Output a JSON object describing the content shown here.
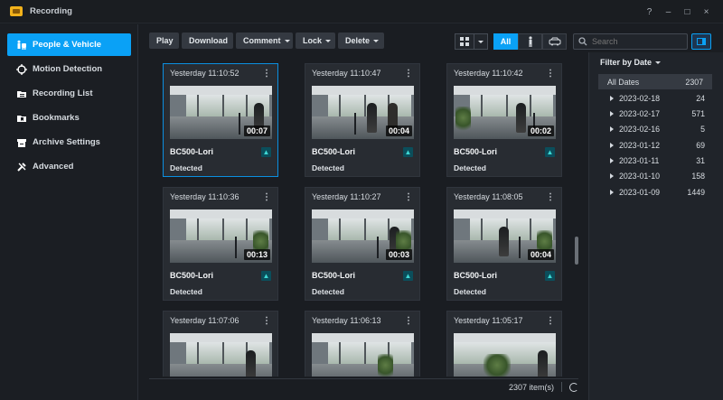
{
  "window": {
    "title": "Recording"
  },
  "window_controls": [
    "?",
    "–",
    "□",
    "×"
  ],
  "sidebar": {
    "items": [
      {
        "label": "People & Vehicle",
        "icon": "people-vehicle-icon",
        "active": true
      },
      {
        "label": "Motion Detection",
        "icon": "motion-target-icon",
        "active": false
      },
      {
        "label": "Recording List",
        "icon": "folder-list-icon",
        "active": false
      },
      {
        "label": "Bookmarks",
        "icon": "bookmark-folder-icon",
        "active": false
      },
      {
        "label": "Archive Settings",
        "icon": "archive-icon",
        "active": false
      },
      {
        "label": "Advanced",
        "icon": "tools-icon",
        "active": false
      }
    ]
  },
  "toolbar": {
    "play": "Play",
    "download": "Download",
    "comment": "Comment",
    "lock": "Lock",
    "delete": "Delete"
  },
  "filters": {
    "all": "All",
    "people_icon": "person-filter-icon",
    "vehicle_icon": "vehicle-filter-icon"
  },
  "search": {
    "placeholder": "Search"
  },
  "cards": [
    {
      "time": "Yesterday 11:10:52",
      "duration": "00:07",
      "camera": "BC500-Lori",
      "event": "Detected"
    },
    {
      "time": "Yesterday 11:10:47",
      "duration": "00:04",
      "camera": "BC500-Lori",
      "event": "Detected"
    },
    {
      "time": "Yesterday 11:10:42",
      "duration": "00:02",
      "camera": "BC500-Lori",
      "event": "Detected"
    },
    {
      "time": "Yesterday 11:10:36",
      "duration": "00:13",
      "camera": "BC500-Lori",
      "event": "Detected"
    },
    {
      "time": "Yesterday 11:10:27",
      "duration": "00:03",
      "camera": "BC500-Lori",
      "event": "Detected"
    },
    {
      "time": "Yesterday 11:08:05",
      "duration": "00:04",
      "camera": "BC500-Lori",
      "event": "Detected"
    },
    {
      "time": "Yesterday 11:07:06",
      "duration": "",
      "camera": "",
      "event": ""
    },
    {
      "time": "Yesterday 11:06:13",
      "duration": "",
      "camera": "",
      "event": ""
    },
    {
      "time": "Yesterday 11:05:17",
      "duration": "",
      "camera": "",
      "event": ""
    }
  ],
  "footer": {
    "items": "2307 item(s)"
  },
  "date_filter": {
    "title": "Filter by Date",
    "all": {
      "label": "All Dates",
      "count": "2307"
    },
    "dates": [
      {
        "label": "2023-02-18",
        "count": "24"
      },
      {
        "label": "2023-02-17",
        "count": "571"
      },
      {
        "label": "2023-02-16",
        "count": "5"
      },
      {
        "label": "2023-01-12",
        "count": "69"
      },
      {
        "label": "2023-01-11",
        "count": "31"
      },
      {
        "label": "2023-01-10",
        "count": "158"
      },
      {
        "label": "2023-01-09",
        "count": "1449"
      }
    ]
  }
}
